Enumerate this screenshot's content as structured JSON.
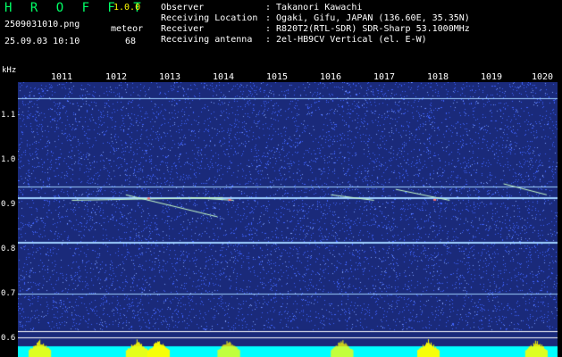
{
  "header": {
    "app_title": "H R O F F T",
    "app_version": "1.0.0",
    "filename": "2509031010.png",
    "datetime": "25.09.03 10:10",
    "meteor_label": "meteor",
    "meteor_count": "68",
    "info": [
      {
        "label": "Observer",
        "value": ": Takanori Kawachi"
      },
      {
        "label": "Receiving Location",
        "value": ": Ogaki, Gifu, JAPAN (136.60E, 35.35N)"
      },
      {
        "label": "Receiver",
        "value": ": R820T2(RTL-SDR) SDR-Sharp 53.1000MHz"
      },
      {
        "label": "Receiving antenna",
        "value": ": 2el-HB9CV Vertical (el. E-W)"
      }
    ]
  },
  "axes": {
    "y_unit": "kHz",
    "y_ticks": [
      "1.1",
      "1.0",
      "0.9",
      "0.8",
      "0.7",
      "0.6"
    ],
    "x_ticks": [
      "1011",
      "1012",
      "1013",
      "1014",
      "1015",
      "1016",
      "1017",
      "1018",
      "1019",
      "1020"
    ]
  },
  "colors": {
    "background": "#1a2a7a",
    "noise": "#3f63ff",
    "tone_line": "#9fd0ff",
    "meteor_trail": "#c8ffc8",
    "meteor_head": "#ff7070",
    "power_base": "#00ffff",
    "power_peak": "#ffff00",
    "grid_line": "#ffffff"
  }
}
